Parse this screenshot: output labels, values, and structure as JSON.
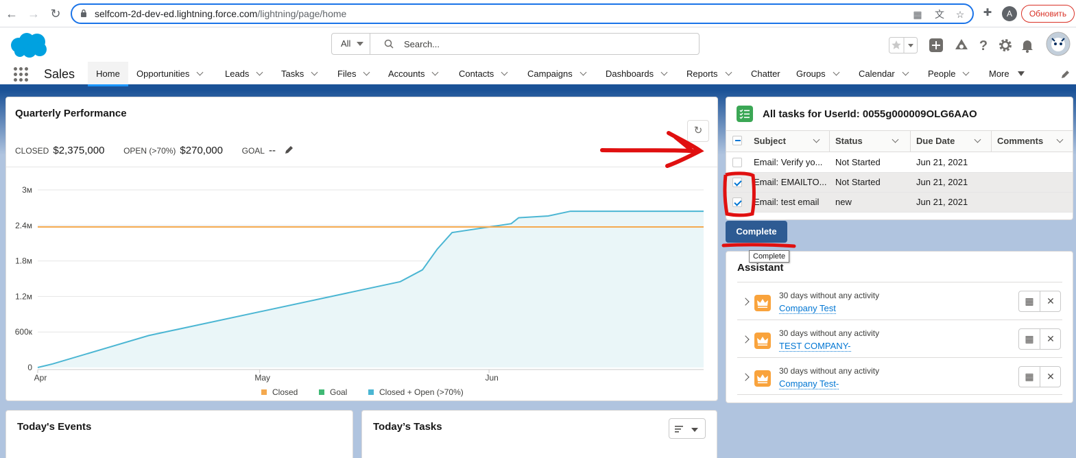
{
  "browser": {
    "url_host": "selfcom-2d-dev-ed.lightning.force.com",
    "url_path": "/lightning/page/home",
    "profile_initial": "A",
    "update_label": "Обновить"
  },
  "header": {
    "search_scope": "All",
    "search_placeholder": "Search..."
  },
  "nav": {
    "app_name": "Sales",
    "tabs": [
      "Home",
      "Opportunities",
      "Leads",
      "Tasks",
      "Files",
      "Accounts",
      "Contacts",
      "Campaigns",
      "Dashboards",
      "Reports",
      "Chatter",
      "Groups",
      "Calendar",
      "People",
      "More"
    ]
  },
  "performance": {
    "title": "Quarterly Performance",
    "closed_label": "CLOSED",
    "closed_value": "$2,375,000",
    "open_label": "OPEN (>70%)",
    "open_value": "$270,000",
    "goal_label": "GOAL",
    "goal_value": "--"
  },
  "chart_data": {
    "type": "area",
    "title": "",
    "y_ticks": [
      "0",
      "600к",
      "1.2м",
      "1.8м",
      "2.4м",
      "3м"
    ],
    "x_ticks": [
      "Apr",
      "May",
      "Jun"
    ],
    "ylim": [
      0,
      3000000
    ],
    "legend": [
      "Closed",
      "Goal",
      "Closed + Open (>70%)"
    ],
    "legend_position": "bottom",
    "colors": {
      "closed": "#f4a94f",
      "goal": "#40b975",
      "closed_open": "#4bb6d3"
    },
    "series": [
      {
        "name": "Closed",
        "points": [
          [
            "2021-04-01",
            2375000
          ],
          [
            "2021-06-30",
            2375000
          ]
        ]
      },
      {
        "name": "Closed + Open (>70%)",
        "points": [
          [
            "2021-04-01",
            0
          ],
          [
            "2021-04-03",
            60000
          ],
          [
            "2021-04-16",
            540000
          ],
          [
            "2021-05-20",
            1450000
          ],
          [
            "2021-05-23",
            1650000
          ],
          [
            "2021-05-25",
            2000000
          ],
          [
            "2021-05-27",
            2280000
          ],
          [
            "2021-06-04",
            2430000
          ],
          [
            "2021-06-05",
            2530000
          ],
          [
            "2021-06-09",
            2560000
          ],
          [
            "2021-06-12",
            2640000
          ],
          [
            "2021-06-30",
            2640000
          ]
        ]
      }
    ]
  },
  "tasks": {
    "title": "All tasks for UserId: 0055g000009OLG6AAO",
    "columns": [
      "Subject",
      "Status",
      "Due Date",
      "Comments"
    ],
    "rows": [
      {
        "subject": "Email: Verify yo...",
        "status": "Not Started",
        "due": "Jun 21, 2021",
        "comments": "",
        "checked": false
      },
      {
        "subject": "Email: EMAILTO...",
        "status": "Not Started",
        "due": "Jun 21, 2021",
        "comments": "",
        "checked": true
      },
      {
        "subject": "Email: test email",
        "status": "new",
        "due": "Jun 21, 2021",
        "comments": "",
        "checked": true
      }
    ],
    "complete_label": "Complete",
    "tooltip": "Complete"
  },
  "assistant": {
    "title": "Assistant",
    "items": [
      {
        "desc": "30 days without any activity",
        "link": "Company Test"
      },
      {
        "desc": "30 days without any activity",
        "link": "TEST COMPANY-"
      },
      {
        "desc": "30 days without any activity",
        "link": "Company Test-"
      }
    ]
  },
  "events": {
    "title": "Today's Events"
  },
  "today_tasks": {
    "title": "Today’s Tasks"
  }
}
